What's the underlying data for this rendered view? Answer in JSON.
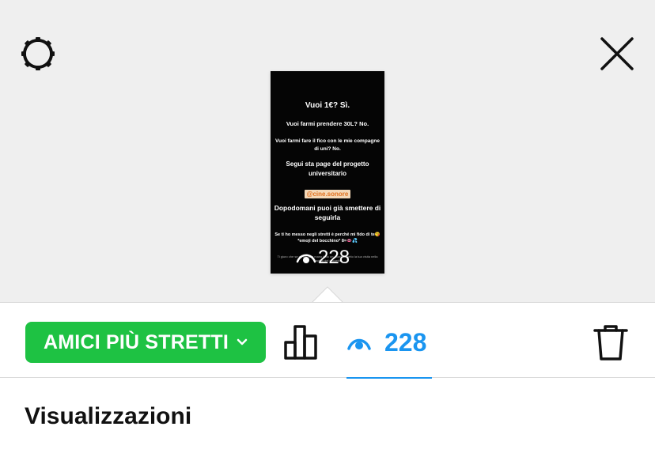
{
  "header": {
    "settings_icon": "gear-icon",
    "close_icon": "close-icon"
  },
  "story": {
    "line1": "Vuoi 1€? Sì.",
    "line2": "Vuoi farmi prendere 30L? No.",
    "line3": "Vuoi farmi fare il fico con le mie compagne di uni? No.",
    "line4": "Segui sta page del progetto universitario",
    "mention": "@cine.sonore",
    "line5": "Dopodomani puoi già smettere di seguirla",
    "line6": "Se ti ho messo negli stretti è perché mi fido di te😘 *emoji del bocchino* 8=👄💦",
    "line7": "Ti giuro che se mi dai una mano ti do un cuore aspetto la tua visita nella pagina del progetto",
    "view_count": "228"
  },
  "action_bar": {
    "audience_label": "AMICI PIÙ STRETTI",
    "audience_color": "#1ec243",
    "views_count": "228",
    "accent_color": "#1a95f0"
  },
  "section": {
    "title": "Visualizzazioni"
  }
}
